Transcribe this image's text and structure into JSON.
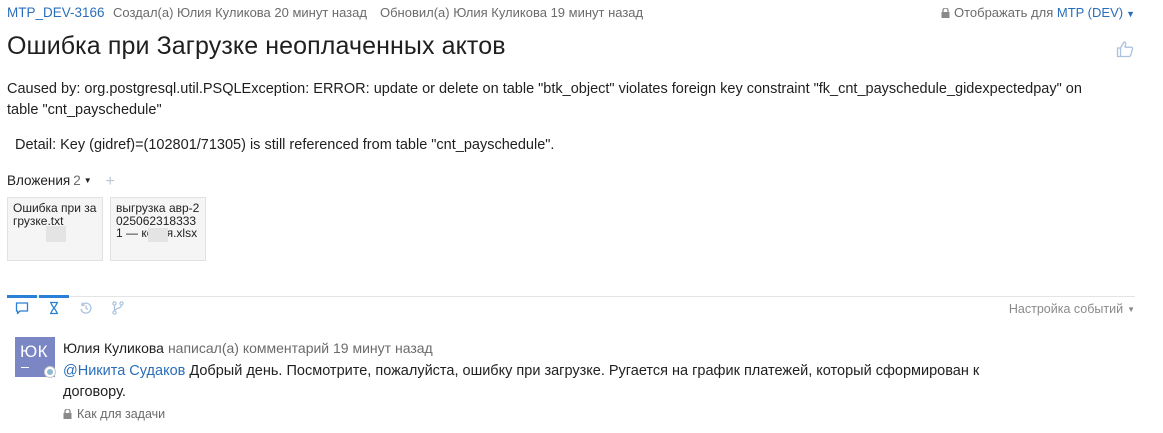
{
  "issue": {
    "key": "MTP_DEV-3166",
    "created": "Создал(а) Юлия Куликова 20 минут назад",
    "updated": "Обновил(а) Юлия Куликова 19 минут назад",
    "display_label": "Отображать для",
    "display_project": "MTP (DEV)",
    "title": "Ошибка при Загрузке неоплаченных актов",
    "description": "Caused by: org.postgresql.util.PSQLException: ERROR: update or delete on table \"btk_object\" violates foreign key constraint \"fk_cnt_payschedule_gidexpectedpay\" on table \"cnt_payschedule\"",
    "detail": "Detail: Key (gidref)=(102801/71305) is still referenced from table \"cnt_payschedule\"."
  },
  "attachments": {
    "label": "Вложения",
    "count": "2",
    "add": "+",
    "files": [
      {
        "name": "Ошибка при загрузке.txt"
      },
      {
        "name": "выгрузка авр-20250623183331 — копия.xlsx"
      }
    ]
  },
  "activity": {
    "tabs": [
      {
        "name": "comments",
        "icon": "comment-icon",
        "active": true
      },
      {
        "name": "history",
        "icon": "hourglass-icon",
        "active": true
      },
      {
        "name": "activity",
        "icon": "history-icon",
        "active": false
      },
      {
        "name": "git",
        "icon": "branch-icon",
        "active": false
      }
    ],
    "settings_label": "Настройка событий"
  },
  "comment": {
    "avatar_initials": "ЮК",
    "author": "Юлия Куликова",
    "action": "написал(а) комментарий 19 минут назад",
    "mention": "@Никита Судаков",
    "text": " Добрый день. Посмотрите, пожалуйста, ошибку при загрузке. Ругается на график платежей, который сформирован к договору.",
    "visibility": "Как для задачи"
  },
  "colors": {
    "link": "#2a6ebb",
    "accent_tab": "#2a7fd6",
    "avatar_bg": "#7b86c4",
    "muted_text": "#6b6b6b"
  }
}
